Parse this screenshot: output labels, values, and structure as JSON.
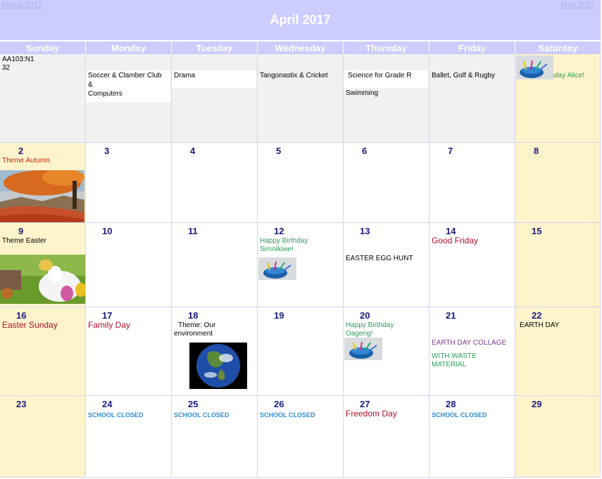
{
  "header": {
    "title": "April 2017",
    "prev_label": "March 2017",
    "next_label": "May 2017"
  },
  "weekdays": [
    "Sunday",
    "Monday",
    "Tuesday",
    "Wednesday",
    "Thursday",
    "Friday",
    "Saturday"
  ],
  "week0": {
    "sunday_code": "AA103:N1",
    "sunday_code2": "32",
    "monday_event": "Soccer & Clamber Club",
    "monday_amp": "&",
    "monday_event2": "Computers",
    "tuesday_event": "Drama",
    "wednesday_event": "Tangonastix & Cricket",
    "thursday_event": "Science for Grade R",
    "thursday_event2": "Swimming",
    "friday_event": "Ballet, Golf & Rugby",
    "saturday_event": "Happy Birthday Alice!"
  },
  "days": {
    "d2": "2",
    "d3": "3",
    "d4": "4",
    "d5": "5",
    "d6": "6",
    "d7": "7",
    "d8": "8",
    "d9": "9",
    "d10": "10",
    "d11": "11",
    "d12": "12",
    "d13": "13",
    "d14": "14",
    "d15": "15",
    "d16": "16",
    "d17": "17",
    "d18": "18",
    "d19": "19",
    "d20": "20",
    "d21": "21",
    "d22": "22",
    "d23": "23",
    "d24": "24",
    "d25": "25",
    "d26": "26",
    "d27": "27",
    "d28": "28",
    "d29": "29"
  },
  "events": {
    "d2": "Theme Autumn",
    "d9": "Theme Easter",
    "d12": "Happy Birthday Simnikiwe!",
    "d13": "EASTER EGG HUNT",
    "d14": "Good Friday",
    "d16": "Easter Sunday",
    "d17": "Family Day",
    "d18": "Theme: Our environment",
    "d20": "Happy Birthday Oageng!",
    "d21a": "EARTH DAY COLLAGE",
    "d21b": "WITH WASTE MATERIAL",
    "d22": "EARTH DAY",
    "d24": "SCHOOL CLOSED",
    "d25": "SCHOOL CLOSED",
    "d26": "SCHOOL CLOSED",
    "d27": "Freedom Day",
    "d28": "SCHOOL CLOSED"
  },
  "colors": {
    "header": "#ccccff",
    "weekend": "#fff3cc",
    "grey": "#f1f1f1",
    "daynum": "#1a1a80",
    "green": "#2aa05a",
    "red": "#cc2200",
    "blue": "#2b8fd6",
    "purple": "#7a3a96"
  },
  "icons": [
    "birthday-cake-icon",
    "autumn-tree-image",
    "easter-bunny-image",
    "earth-globe-image"
  ]
}
